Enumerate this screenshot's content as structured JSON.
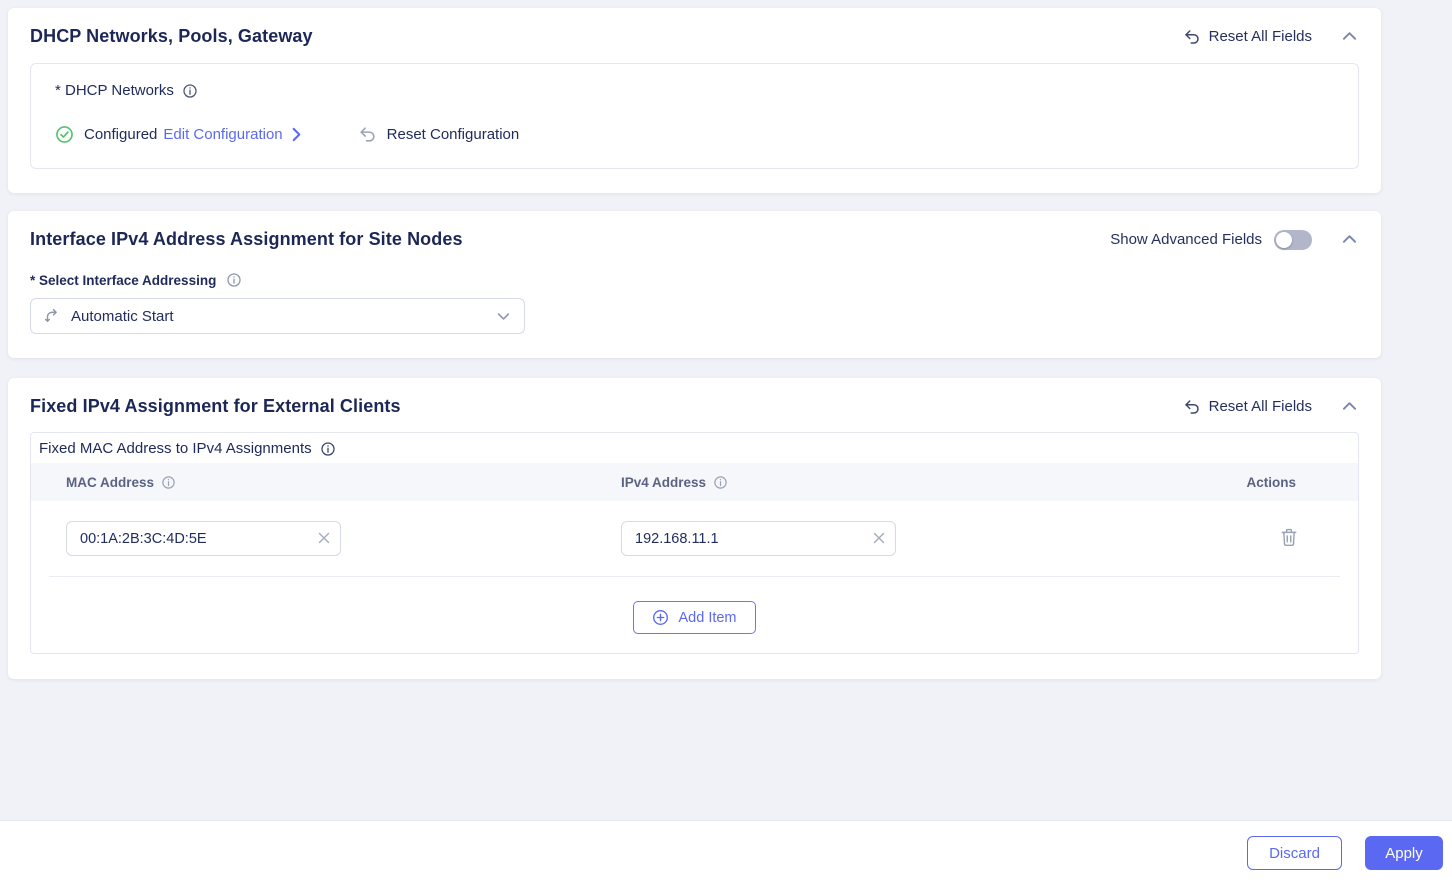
{
  "colors": {
    "accent": "#5b69f2",
    "title_navy": "#1d2757",
    "success_green": "#54c36e",
    "icon_gray": "#9aa2b8",
    "page_bg": "#f1f2f7"
  },
  "dhcp_card": {
    "title": "DHCP Networks, Pools, Gateway",
    "reset_all_label": "Reset All Fields",
    "field_label": "* DHCP Networks",
    "status_text": "Configured",
    "edit_link_label": "Edit Configuration",
    "reset_config_label": "Reset Configuration",
    "icons": {
      "reset": "undo-arrow-icon",
      "collapse": "chevron-up-icon",
      "info": "info-circle-icon",
      "status": "check-circle-icon",
      "link_arrow": "chevron-right-icon"
    }
  },
  "interface_card": {
    "title": "Interface IPv4 Address Assignment for Site Nodes",
    "advanced_toggle_label": "Show Advanced Fields",
    "toggle_state": "off",
    "select_label": "* Select Interface Addressing",
    "select_value": "Automatic Start",
    "icons": {
      "select_leading": "route-icon",
      "select_trailing": "chevron-down-icon",
      "collapse": "chevron-up-icon",
      "info": "info-circle-icon"
    }
  },
  "fixed_card": {
    "title": "Fixed IPv4 Assignment for External Clients",
    "reset_all_label": "Reset All Fields",
    "table_label": "Fixed MAC Address to IPv4 Assignments",
    "columns": {
      "mac": "MAC Address",
      "ipv4": "IPv4 Address",
      "actions": "Actions"
    },
    "rows": [
      {
        "mac": "00:1A:2B:3C:4D:5E",
        "ipv4": "192.168.11.1"
      }
    ],
    "add_item_label": "Add Item",
    "icons": {
      "reset": "undo-arrow-icon",
      "collapse": "chevron-up-icon",
      "info": "info-circle-icon",
      "row_action": "trash-icon",
      "clear": "x-clear-icon",
      "add": "plus-circle-icon"
    }
  },
  "footer": {
    "discard_label": "Discard",
    "apply_label": "Apply"
  }
}
